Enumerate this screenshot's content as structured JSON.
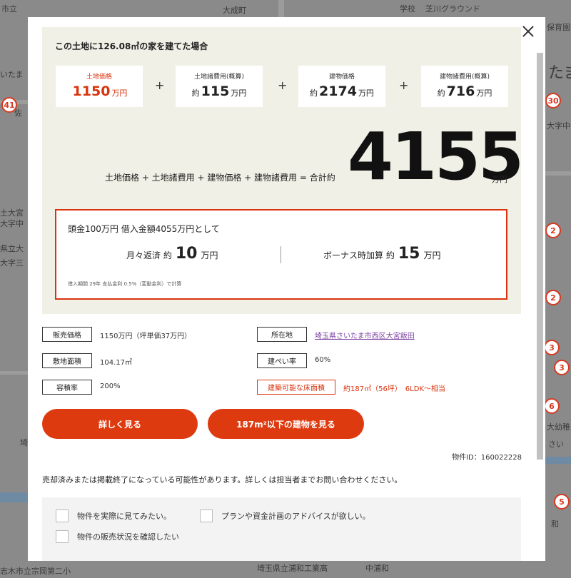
{
  "map": {
    "labels": [
      "市立",
      "大成町",
      "学校",
      "芝川グラウンド",
      "保育園",
      "いたま",
      "佐",
      "大字中",
      "たま",
      "土大宮",
      "大字中",
      "県立大",
      "大字三",
      "埼",
      "大幼稚",
      "さい",
      "埼玉県立浦和工業高",
      "中浦和",
      "志木市立宗岡第二小",
      "和"
    ],
    "pins": [
      "41",
      "30",
      "2",
      "2",
      "3",
      "3",
      "6",
      "5"
    ]
  },
  "modal": {
    "close_icon": "close-icon",
    "sim_title": "この土地に126.08㎡の家を建てた場合",
    "costs": [
      {
        "label": "土地価格",
        "prefix": "",
        "value": "1150",
        "unit": "万円"
      },
      {
        "label": "土地諸費用(概算)",
        "prefix": "約",
        "value": "115",
        "unit": "万円"
      },
      {
        "label": "建物価格",
        "prefix": "約",
        "value": "2174",
        "unit": "万円"
      },
      {
        "label": "建物諸費用(概算)",
        "prefix": "約",
        "value": "716",
        "unit": "万円"
      }
    ],
    "plus": "+",
    "formula": "土地価格 + 土地諸費用 + 建物価格 + 建物諸費用 = 合計約",
    "total": "4155",
    "total_unit": "万円",
    "loan": {
      "title": "頭金100万円 借入金額4055万円として",
      "monthly_label": "月々返済 約",
      "monthly_value": "10",
      "monthly_unit": "万円",
      "bonus_label": "ボーナス時加算 約",
      "bonus_value": "15",
      "bonus_unit": "万円",
      "note": "借入期間 29年 支払金利 0.5%（変動金利）で計算"
    },
    "details": {
      "price_tag": "販売価格",
      "price_value": "1150万円（坪単価37万円）",
      "location_tag": "所在地",
      "location_value": "埼玉県さいたま市西区大宮飯田",
      "area_tag": "敷地面積",
      "area_value": "104.17㎡",
      "coverage_tag": "建ぺい率",
      "coverage_value": "60%",
      "far_tag": "容積率",
      "far_value": "200%",
      "floor_tag": "建築可能な床面積",
      "floor_value": "約187㎡（56坪）　6LDK～相当"
    },
    "buttons": {
      "more": "詳しく見る",
      "buildings": "187m²以下の建物を見る"
    },
    "property_id": "物件ID：160022228",
    "notice": "売却済みまたは掲載終了になっている可能性があります。詳しくは担当者までお問い合わせください。",
    "inquiry": {
      "options": [
        "物件を実際に見てみたい。",
        "プランや資金計画のアドバイスが欲しい。",
        "物件の販売状況を確認したい"
      ]
    }
  }
}
